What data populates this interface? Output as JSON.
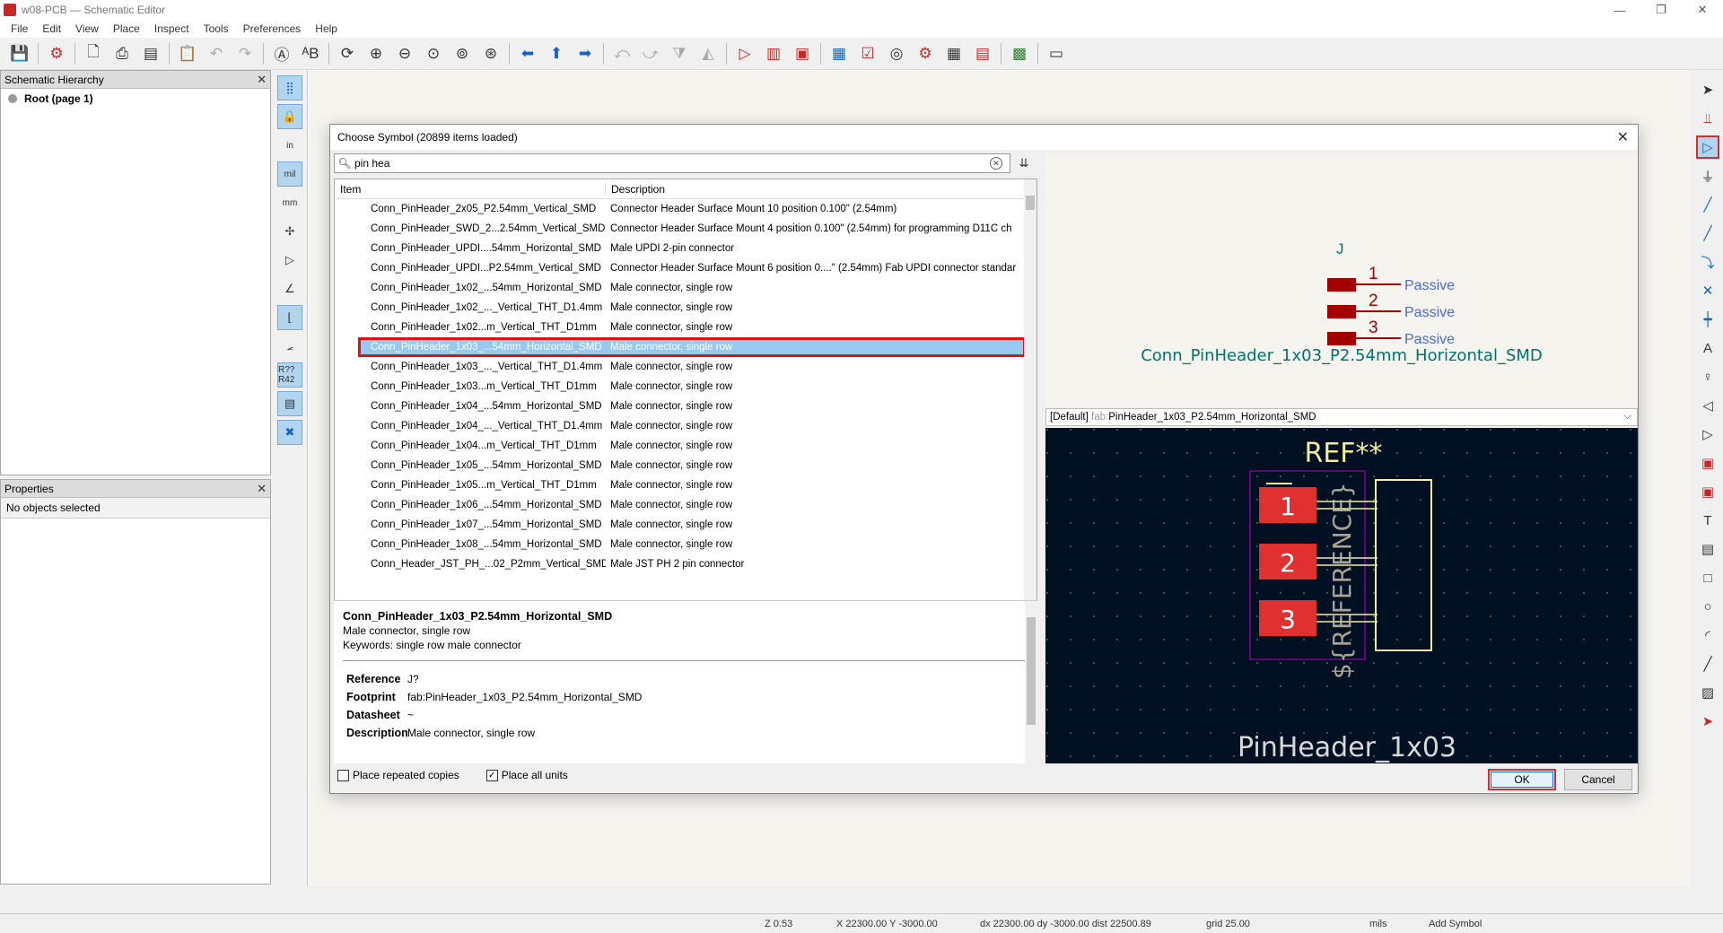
{
  "window": {
    "title": "w08-PCB — Schematic Editor"
  },
  "menu": [
    "File",
    "Edit",
    "View",
    "Place",
    "Inspect",
    "Tools",
    "Preferences",
    "Help"
  ],
  "hierarchy": {
    "title": "Schematic Hierarchy",
    "root": "Root (page 1)"
  },
  "properties": {
    "title": "Properties",
    "empty": "No objects selected"
  },
  "left_tools": {
    "in": "in",
    "mil": "mil",
    "mm": "mm",
    "r42": "R?? R42"
  },
  "dialog": {
    "title": "Choose Symbol (20899 items loaded)",
    "search_value": "pin hea",
    "col_item": "Item",
    "col_desc": "Description",
    "rows": [
      {
        "item": "Conn_PinHeader_2x05_P2.54mm_Vertical_SMD",
        "desc": "Connector Header Surface Mount 10 position 0.100\" (2.54mm)"
      },
      {
        "item": "Conn_PinHeader_SWD_2...2.54mm_Vertical_SMD",
        "desc": "Connector Header Surface Mount 4 position 0.100\" (2.54mm) for programming D11C ch"
      },
      {
        "item": "Conn_PinHeader_UPDI....54mm_Horizontal_SMD",
        "desc": "Male UPDI 2-pin connector"
      },
      {
        "item": "Conn_PinHeader_UPDI...P2.54mm_Vertical_SMD",
        "desc": "Connector Header Surface Mount 6 position 0....\" (2.54mm) Fab UPDI connector standar"
      },
      {
        "item": "Conn_PinHeader_1x02_...54mm_Horizontal_SMD",
        "desc": "Male connector, single row"
      },
      {
        "item": "Conn_PinHeader_1x02_..._Vertical_THT_D1.4mm",
        "desc": "Male connector, single row"
      },
      {
        "item": "Conn_PinHeader_1x02...m_Vertical_THT_D1mm",
        "desc": "Male connector, single row"
      },
      {
        "item": "Conn_PinHeader_1x03_...54mm_Horizontal_SMD",
        "desc": "Male connector, single row"
      },
      {
        "item": "Conn_PinHeader_1x03_..._Vertical_THT_D1.4mm",
        "desc": "Male connector, single row"
      },
      {
        "item": "Conn_PinHeader_1x03...m_Vertical_THT_D1mm",
        "desc": "Male connector, single row"
      },
      {
        "item": "Conn_PinHeader_1x04_...54mm_Horizontal_SMD",
        "desc": "Male connector, single row"
      },
      {
        "item": "Conn_PinHeader_1x04_..._Vertical_THT_D1.4mm",
        "desc": "Male connector, single row"
      },
      {
        "item": "Conn_PinHeader_1x04...m_Vertical_THT_D1mm",
        "desc": "Male connector, single row"
      },
      {
        "item": "Conn_PinHeader_1x05_...54mm_Horizontal_SMD",
        "desc": "Male connector, single row"
      },
      {
        "item": "Conn_PinHeader_1x05...m_Vertical_THT_D1mm",
        "desc": "Male connector, single row"
      },
      {
        "item": "Conn_PinHeader_1x06_...54mm_Horizontal_SMD",
        "desc": "Male connector, single row"
      },
      {
        "item": "Conn_PinHeader_1x07_...54mm_Horizontal_SMD",
        "desc": "Male connector, single row"
      },
      {
        "item": "Conn_PinHeader_1x08_...54mm_Horizontal_SMD",
        "desc": "Male connector, single row"
      },
      {
        "item": "Conn_Header_JST_PH_...02_P2mm_Vertical_SMD",
        "desc": "Male JST PH 2 pin connector"
      }
    ],
    "selected_index": 7,
    "detail": {
      "name": "Conn_PinHeader_1x03_P2.54mm_Horizontal_SMD",
      "desc": "Male connector, single row",
      "keywords": "Keywords: single row male connector",
      "reference_label": "Reference",
      "reference": "J?",
      "footprint_label": "Footprint",
      "footprint": "fab:PinHeader_1x03_P2.54mm_Horizontal_SMD",
      "datasheet_label": "Datasheet",
      "datasheet": "~",
      "description_label": "Description",
      "description": "Male connector, single row"
    },
    "place_repeated": "Place repeated copies",
    "place_all": "Place all units",
    "place_repeated_checked": false,
    "place_all_checked": true,
    "symbol_preview": {
      "ref": "J",
      "pins": [
        "1",
        "2",
        "3"
      ],
      "pin_type": "Passive",
      "value": "Conn_PinHeader_1x03_P2.54mm_Horizontal_SMD"
    },
    "footprint_select": {
      "default": "[Default]",
      "lib": "fab:",
      "name": "PinHeader_1x03_P2.54mm_Horizontal_SMD"
    },
    "footprint_preview": {
      "ref": "REF**",
      "ref_vertical": "${REFERENCE}",
      "pads": [
        "1",
        "2",
        "3"
      ],
      "value": "PinHeader_1x03"
    },
    "ok": "OK",
    "cancel": "Cancel"
  },
  "status": {
    "zoom": "Z 0.53",
    "xy": "X 22300.00  Y -3000.00",
    "dxy": "dx 22300.00  dy -3000.00  dist 22500.89",
    "grid": "grid 25.00",
    "units": "mils",
    "mode": "Add Symbol"
  },
  "colors": {
    "accent": "#0078d7",
    "highlight": "#e01010",
    "selection": "#99c9ef",
    "symbol_body": "#a40000",
    "pin_text": "#4a6ad0",
    "value_text": "#00746b",
    "pcb_bg": "#001023",
    "silk": "#f2eda1",
    "pad": "#e03030",
    "courtyard": "#c000c0"
  }
}
